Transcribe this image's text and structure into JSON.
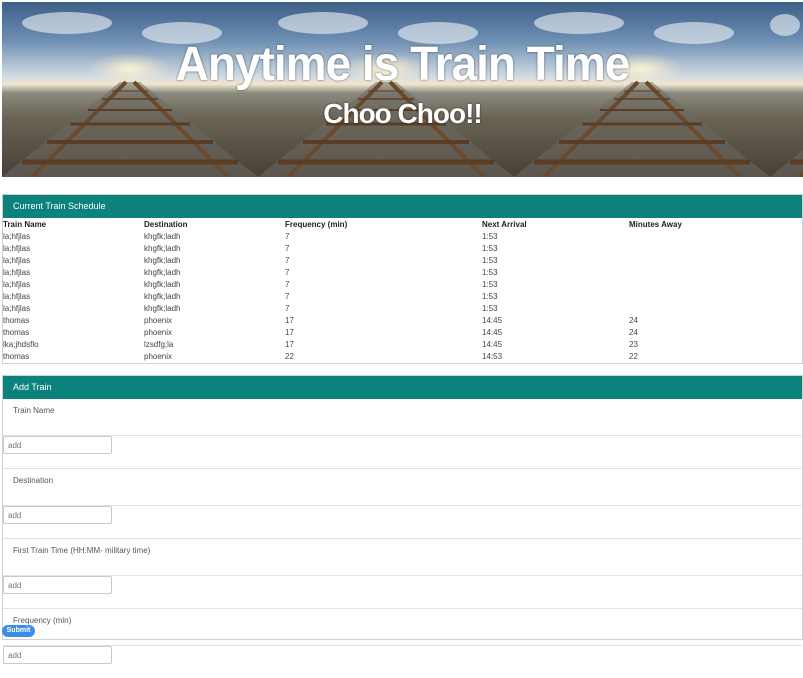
{
  "banner": {
    "title": "Anytime is Train Time",
    "subtitle": "Choo Choo!!"
  },
  "schedule": {
    "header": "Current Train Schedule",
    "columns": [
      "Train Name",
      "Destination",
      "Frequency (min)",
      "Next Arrival",
      "Minutes Away"
    ],
    "rows": [
      [
        "la;hfjlas",
        "khgfk;ladh",
        "7",
        "1:53",
        ""
      ],
      [
        "la;hfjlas",
        "khgfk;ladh",
        "7",
        "1:53",
        ""
      ],
      [
        "la;hfjlas",
        "khgfk;ladh",
        "7",
        "1:53",
        ""
      ],
      [
        "la;hfjlas",
        "khgfk;ladh",
        "7",
        "1:53",
        ""
      ],
      [
        "la;hfjlas",
        "khgfk;ladh",
        "7",
        "1:53",
        ""
      ],
      [
        "la;hfjlas",
        "khgfk;ladh",
        "7",
        "1:53",
        ""
      ],
      [
        "la;hfjlas",
        "khgfk;ladh",
        "7",
        "1:53",
        ""
      ],
      [
        "thomas",
        "phoenix",
        "17",
        "14:45",
        "24"
      ],
      [
        "thomas",
        "phoenix",
        "17",
        "14:45",
        "24"
      ],
      [
        "lka;jhdsflo",
        "lzsdfg;la",
        "17",
        "14:45",
        "23"
      ],
      [
        "thomas",
        "phoenix",
        "22",
        "14:53",
        "22"
      ]
    ]
  },
  "add_train": {
    "header": "Add Train",
    "fields": [
      {
        "label": "Train Name",
        "placeholder": "add"
      },
      {
        "label": "Destination",
        "placeholder": "add"
      },
      {
        "label": "First Train Time (HH:MM- military time)",
        "placeholder": "add"
      },
      {
        "label": "Frequency (min)",
        "placeholder": "add"
      }
    ],
    "submit_label": "Submit"
  },
  "colors": {
    "header_teal": "#0b827c",
    "submit_blue": "#3a8ee6"
  }
}
